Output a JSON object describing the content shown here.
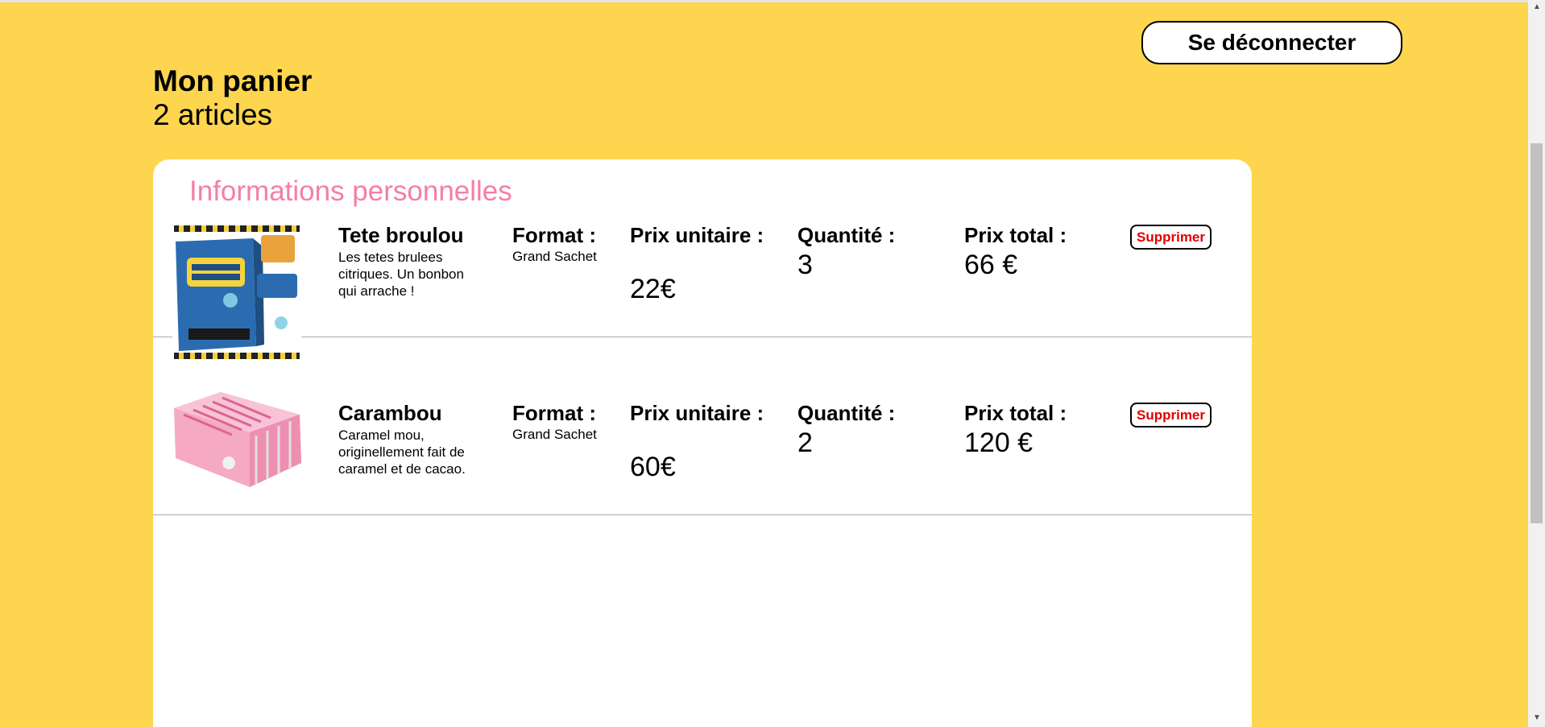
{
  "header": {
    "logout_label": "Se déconnecter",
    "title": "Mon panier",
    "count": "2 articles"
  },
  "panel": {
    "title": "Informations personnelles"
  },
  "labels": {
    "format": "Format :",
    "unit_price": "Prix unitaire :",
    "quantity": "Quantité :",
    "total": "Prix total :",
    "delete": "Supprimer"
  },
  "items": [
    {
      "name": "Tete broulou",
      "description": "Les tetes brulees citriques. Un bonbon qui arrache !",
      "format": "Grand Sachet",
      "unit_price": "22€",
      "quantity": "3",
      "total": "66 €",
      "image": "tetes-brulees-box-image"
    },
    {
      "name": "Carambou",
      "description": "Caramel mou, originellement fait de caramel et de cacao.",
      "format": "Grand Sachet",
      "unit_price": "60€",
      "quantity": "2",
      "total": "120 €",
      "image": "carambar-box-image"
    }
  ],
  "colors": {
    "background": "#FED54E",
    "accent_pink": "#F57DAB",
    "delete_red": "#E00000"
  }
}
